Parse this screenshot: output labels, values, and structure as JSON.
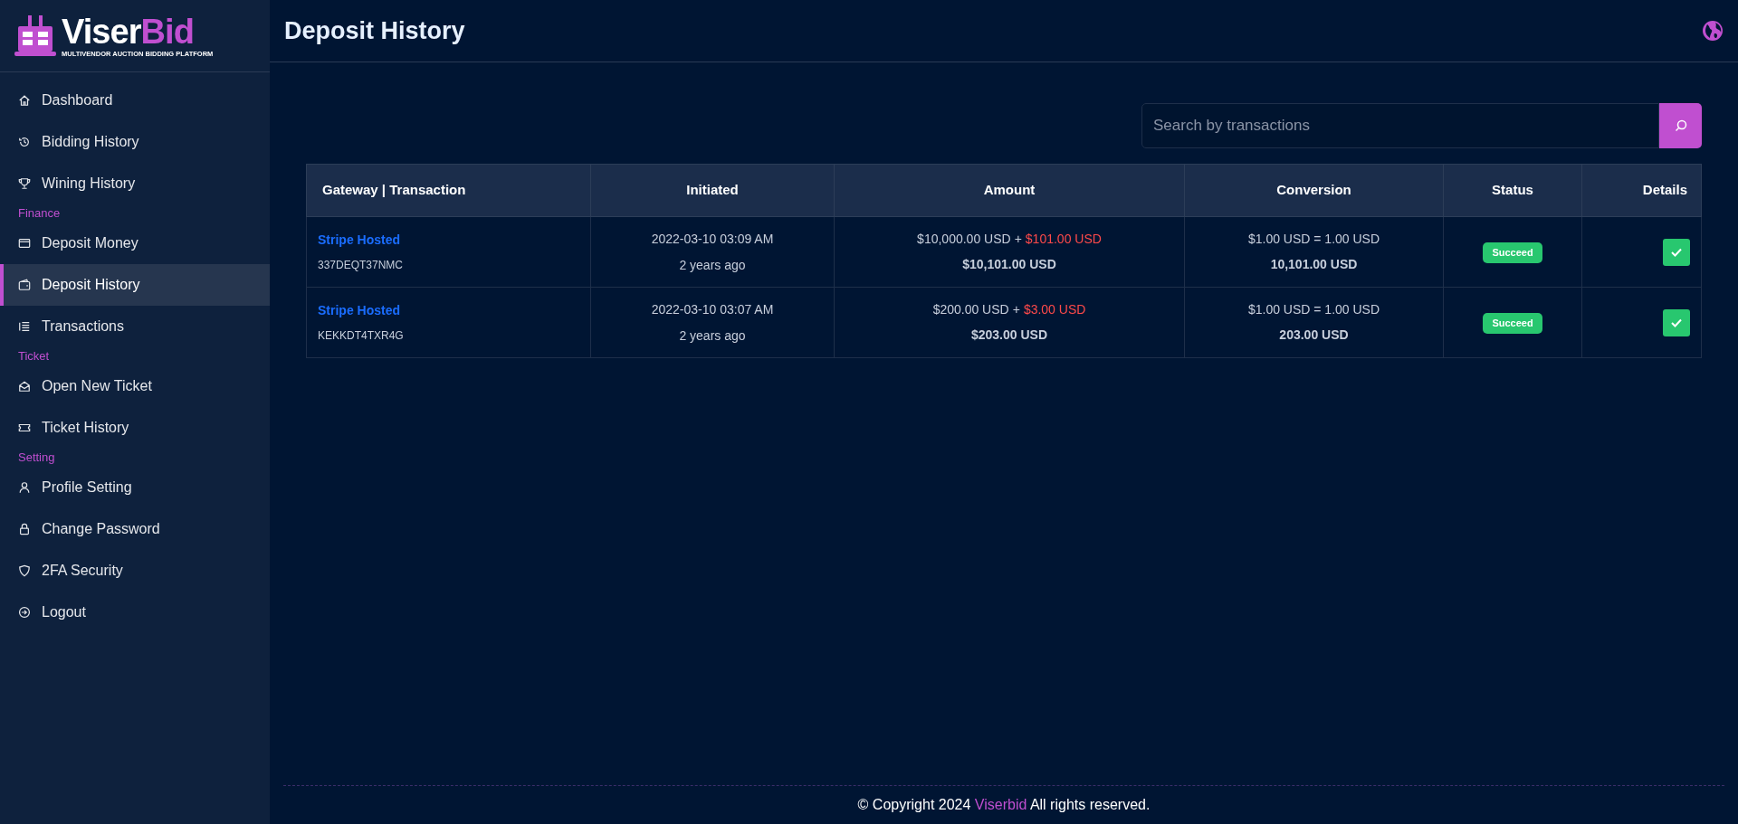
{
  "sidebar": {
    "logo": {
      "first": "Viser",
      "second": "Bid",
      "tagline": "MULTIVENDOR AUCTION BIDDING PLATFORM"
    },
    "groups": [
      {
        "items": [
          {
            "label": "Dashboard",
            "selected": false
          },
          {
            "label": "Bidding History",
            "selected": false
          },
          {
            "label": "Wining History",
            "selected": false
          }
        ]
      },
      {
        "heading": "Finance",
        "items": [
          {
            "label": "Deposit Money",
            "selected": false
          },
          {
            "label": "Deposit History",
            "selected": true
          },
          {
            "label": "Transactions",
            "selected": false
          }
        ]
      },
      {
        "heading": "Ticket",
        "items": [
          {
            "label": "Open New Ticket",
            "selected": false
          },
          {
            "label": "Ticket History",
            "selected": false
          }
        ]
      },
      {
        "heading": "Setting",
        "items": [
          {
            "label": "Profile Setting",
            "selected": false
          },
          {
            "label": "Change Password",
            "selected": false
          },
          {
            "label": "2FA Security",
            "selected": false
          },
          {
            "label": "Logout",
            "selected": false
          }
        ]
      }
    ]
  },
  "header": {
    "title": "Deposit History"
  },
  "search": {
    "placeholder": "Search by transactions"
  },
  "table": {
    "columns": [
      "Gateway | Transaction",
      "Initiated",
      "Amount",
      "Conversion",
      "Status",
      "Details"
    ],
    "rows": [
      {
        "gateway": "Stripe Hosted",
        "trx": "337DEQT37NMC",
        "date": "2022-03-10 03:09 AM",
        "ago": "2 years ago",
        "amount": "$10,000.00 USD",
        "plus": "+",
        "charge": "$101.00 USD",
        "total": "$10,101.00 USD",
        "rate": "$1.00 USD = 1.00 USD",
        "converted": "10,101.00 USD",
        "status": {
          "label": "Succeed",
          "kind": "success"
        }
      },
      {
        "gateway": "Stripe Hosted",
        "trx": "KEKKDT4TXR4G",
        "date": "2022-03-10 03:07 AM",
        "ago": "2 years ago",
        "amount": "$200.00 USD",
        "plus": "+",
        "charge": "$3.00 USD",
        "total": "$203.00 USD",
        "rate": "$1.00 USD = 1.00 USD",
        "converted": "203.00 USD",
        "status": {
          "label": "Succeed",
          "kind": "success"
        }
      }
    ]
  },
  "footer": {
    "before": "© Copyright 2024",
    "link": "Viserbid",
    "after": "All rights reserved."
  }
}
